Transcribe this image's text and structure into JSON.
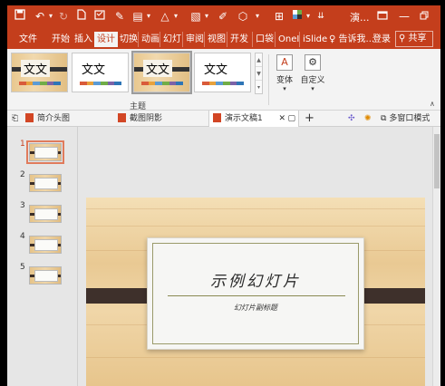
{
  "titlebar": {
    "title": "演...",
    "icons": [
      "save-icon",
      "undo-icon",
      "redo-icon",
      "new-doc-icon",
      "open-icon",
      "format-painter-icon",
      "layout-icon",
      "shape-icon",
      "arrange-icon",
      "effect-icon",
      "dialog-launcher-icon",
      "grid-icon",
      "window-restore-icon",
      "minimize-icon",
      "close-icon"
    ]
  },
  "tabs": [
    "文件",
    "开始",
    "插入",
    "设计",
    "切换",
    "动画",
    "幻灯",
    "审阅",
    "视图",
    "开发",
    "口袋",
    "OneI",
    "iSlide",
    "告诉我..."
  ],
  "active_tab": "设计",
  "account": {
    "login": "登录",
    "share": "共享"
  },
  "ribbon": {
    "themes": [
      {
        "text": "文文",
        "style": "wood"
      },
      {
        "text": "文文",
        "style": "plain"
      },
      {
        "text": "文文",
        "style": "wood-selected"
      },
      {
        "text": "文文",
        "style": "plain"
      }
    ],
    "swatch_colors": [
      "#d95b3a",
      "#e8a23c",
      "#5b9bd5",
      "#70ad47",
      "#7c63a8",
      "#2e75b6"
    ],
    "group_label": "主题",
    "variant_label": "变体",
    "custom_label": "自定义"
  },
  "doc_tabs": [
    {
      "label": "简介头图",
      "active": false
    },
    {
      "label": "截图阴影",
      "active": false
    },
    {
      "label": "演示文稿1",
      "active": true
    }
  ],
  "doc_toolbar": {
    "multi_window": "多窗口模式"
  },
  "slides": [
    {
      "number": "1",
      "selected": true
    },
    {
      "number": "2",
      "selected": false
    },
    {
      "number": "3",
      "selected": false
    },
    {
      "number": "4",
      "selected": false
    },
    {
      "number": "5",
      "selected": false
    }
  ],
  "slide": {
    "title": "示例幻灯片",
    "subtitle": "幻灯片副标题"
  }
}
